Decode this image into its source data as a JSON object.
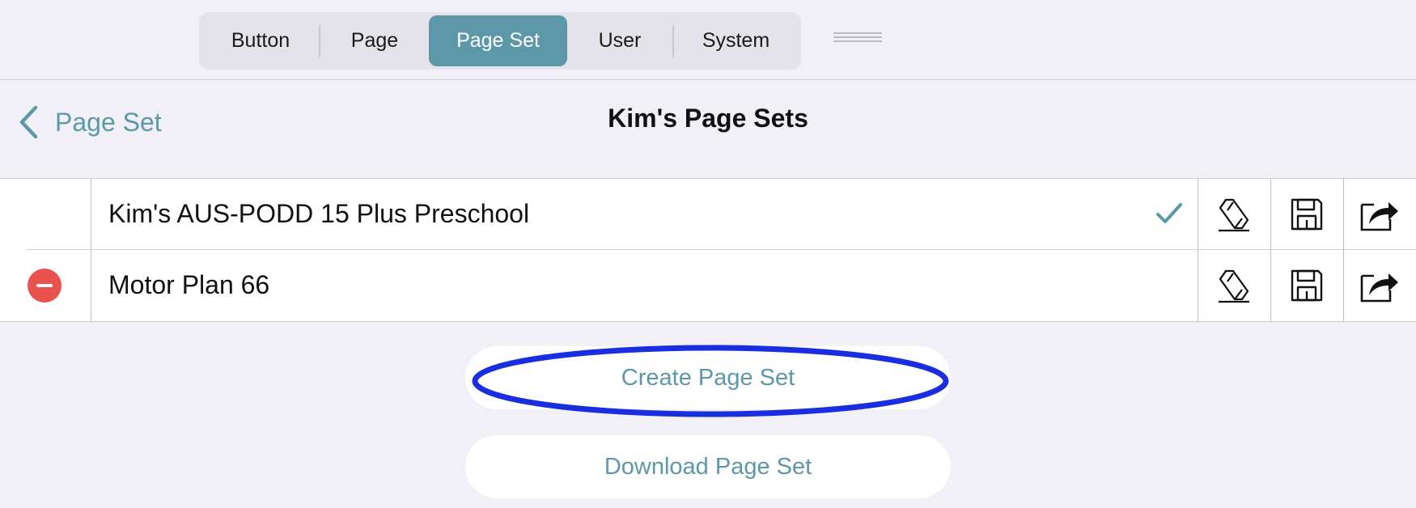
{
  "tabs": [
    {
      "label": "Button",
      "active": false
    },
    {
      "label": "Page",
      "active": false
    },
    {
      "label": "Page Set",
      "active": true
    },
    {
      "label": "User",
      "active": false
    },
    {
      "label": "System",
      "active": false
    }
  ],
  "nav": {
    "back_label": "Page Set",
    "title": "Kim's Page Sets"
  },
  "page_sets": [
    {
      "name": "Kim's AUS-PODD 15 Plus Preschool",
      "selected": true,
      "deletable": false,
      "actions": [
        "pencil-icon",
        "floppy-disk-icon",
        "share-icon"
      ]
    },
    {
      "name": "Motor Plan 66",
      "selected": false,
      "deletable": true,
      "actions": [
        "pencil-icon",
        "floppy-disk-icon",
        "share-icon"
      ]
    }
  ],
  "buttons": {
    "create_label": "Create Page Set",
    "download_label": "Download Page Set"
  },
  "colors": {
    "accent": "#5d98a8",
    "background": "#f1f0f6",
    "delete": "#e9524d",
    "annotation_circle": "#1a2ee0"
  }
}
